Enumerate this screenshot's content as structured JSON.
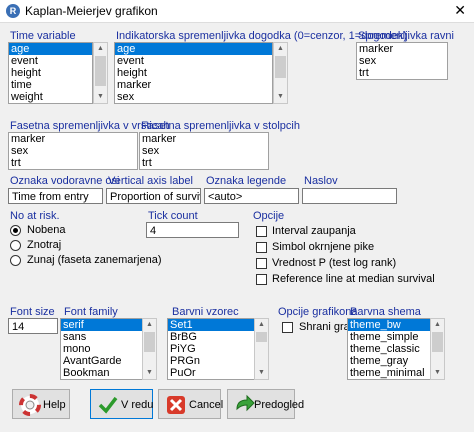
{
  "window": {
    "title": "Kaplan-Meierjev grafikon",
    "close_glyph": "✕",
    "app_icon": "R"
  },
  "time_variable": {
    "label": "Time variable",
    "items": [
      "age",
      "event",
      "height",
      "time",
      "weight"
    ],
    "selected": 0
  },
  "indicator": {
    "label": "Indikatorska spremenljivka dogodka (0=cenzor, 1=dogodek)",
    "items": [
      "age",
      "event",
      "height",
      "marker",
      "sex"
    ],
    "selected": 0
  },
  "strata": {
    "label": "Spremenljivka ravni",
    "items": [
      "marker",
      "sex",
      "trt"
    ]
  },
  "facet_rows": {
    "label": "Fasetna spremenljivka v vrsticah",
    "items": [
      "marker",
      "sex",
      "trt"
    ]
  },
  "facet_cols": {
    "label": "Fasetna spremenljivka v stolpcih",
    "items": [
      "marker",
      "sex",
      "trt"
    ]
  },
  "x_axis": {
    "label": "Oznaka vodoravne osi",
    "value": "Time from entry"
  },
  "y_axis": {
    "label": "Vertical axis label",
    "value": "Proportion of survival"
  },
  "legend": {
    "label": "Oznaka legende",
    "value": "<auto>"
  },
  "title": {
    "label": "Naslov",
    "value": ""
  },
  "at_risk": {
    "label": "No at risk.",
    "options": [
      "Nobena",
      "Znotraj",
      "Zunaj (faseta zanemarjena)"
    ],
    "selected": 0
  },
  "tick_count": {
    "label": "Tick count",
    "value": "4"
  },
  "options": {
    "label": "Opcije",
    "items": [
      "Interval zaupanja",
      "Simbol okrnjene pike",
      "Vrednost P (test log rank)",
      "Reference line at median survival"
    ]
  },
  "font_size": {
    "label": "Font size",
    "value": "14"
  },
  "font_family": {
    "label": "Font family",
    "items": [
      "serif",
      "sans",
      "mono",
      "AvantGarde",
      "Bookman"
    ],
    "selected": 0
  },
  "palette": {
    "label": "Barvni vzorec",
    "items": [
      "Set1",
      "BrBG",
      "PiYG",
      "PRGn",
      "PuOr"
    ],
    "selected": 0
  },
  "graph_options": {
    "label": "Opcije grafikona",
    "save_label": "Shrani graf"
  },
  "color_scheme": {
    "label": "Barvna shema",
    "items": [
      "theme_bw",
      "theme_simple",
      "theme_classic",
      "theme_gray",
      "theme_minimal"
    ],
    "selected": 0
  },
  "buttons": {
    "help": "Help",
    "ok": "V redu",
    "cancel": "Cancel",
    "preview": "Predogled"
  },
  "colors": {
    "selection": "#0078d7",
    "label_blue": "#1a2fa0",
    "dialog_bg": "#f0f0f0"
  }
}
